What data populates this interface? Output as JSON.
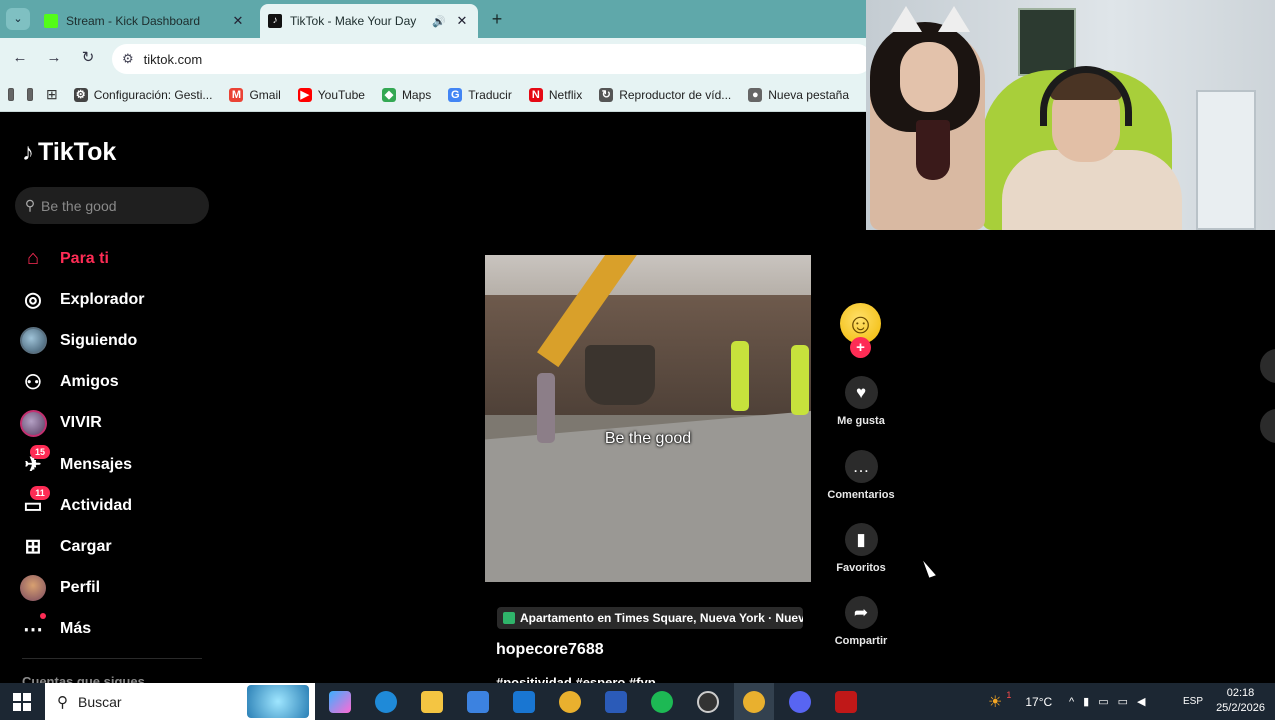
{
  "browser": {
    "tabs": [
      {
        "title": "Stream - Kick Dashboard",
        "favicon_color": "#53fc18",
        "active": false
      },
      {
        "title": "TikTok - Make Your Day",
        "favicon_color": "#111111",
        "active": true
      }
    ],
    "url": "tiktok.com",
    "bookmarks": [
      {
        "label": "Configuración: Gesti...",
        "icon": "gear-icon",
        "color": "#444444"
      },
      {
        "label": "Gmail",
        "icon": "gmail-icon",
        "color": "#ea4335"
      },
      {
        "label": "YouTube",
        "icon": "youtube-icon",
        "color": "#ff0000"
      },
      {
        "label": "Maps",
        "icon": "maps-icon",
        "color": "#34a853"
      },
      {
        "label": "Traducir",
        "icon": "translate-icon",
        "color": "#4285f4"
      },
      {
        "label": "Netflix",
        "icon": "netflix-icon",
        "color": "#e50914"
      },
      {
        "label": "Reproductor de víd...",
        "icon": "player-icon",
        "color": "#555555"
      },
      {
        "label": "Nueva pestaña",
        "icon": "chrome-icon",
        "color": "#666666"
      }
    ]
  },
  "tiktok": {
    "logo": "TikTok",
    "search_placeholder": "Be the good",
    "nav": [
      {
        "label": "Para ti",
        "icon": "home-icon",
        "active": true,
        "badge": ""
      },
      {
        "label": "Explorador",
        "icon": "compass-icon",
        "active": false,
        "badge": ""
      },
      {
        "label": "Siguiendo",
        "icon": "following-avatar",
        "active": false,
        "badge": ""
      },
      {
        "label": "Amigos",
        "icon": "friends-icon",
        "active": false,
        "badge": ""
      },
      {
        "label": "VIVIR",
        "icon": "live-avatar",
        "active": false,
        "badge": ""
      },
      {
        "label": "Mensajes",
        "icon": "messages-icon",
        "active": false,
        "badge": "15"
      },
      {
        "label": "Actividad",
        "icon": "activity-icon",
        "active": false,
        "badge": "11"
      },
      {
        "label": "Cargar",
        "icon": "upload-icon",
        "active": false,
        "badge": ""
      },
      {
        "label": "Perfil",
        "icon": "profile-avatar",
        "active": false,
        "badge": ""
      },
      {
        "label": "Más",
        "icon": "more-icon",
        "active": false,
        "badge": "dot"
      }
    ],
    "following_heading": "Cuentas que sigues",
    "video": {
      "caption": "Be the good",
      "location": "Apartamento en Times Square, Nueva York · Nueva Y",
      "author": "hopecore7688",
      "hashtags": "#positividad #espero #fyp..."
    },
    "actions": [
      {
        "label": "Me gusta",
        "icon": "heart-icon"
      },
      {
        "label": "Comentarios",
        "icon": "comment-icon"
      },
      {
        "label": "Favoritos",
        "icon": "bookmark-icon"
      },
      {
        "label": "Compartir",
        "icon": "share-icon"
      }
    ]
  },
  "taskbar": {
    "search_placeholder": "Buscar",
    "weather": "17°C",
    "weather_badge": "1",
    "language": "ESP",
    "time": "02:18",
    "date": "25/2/2026"
  }
}
